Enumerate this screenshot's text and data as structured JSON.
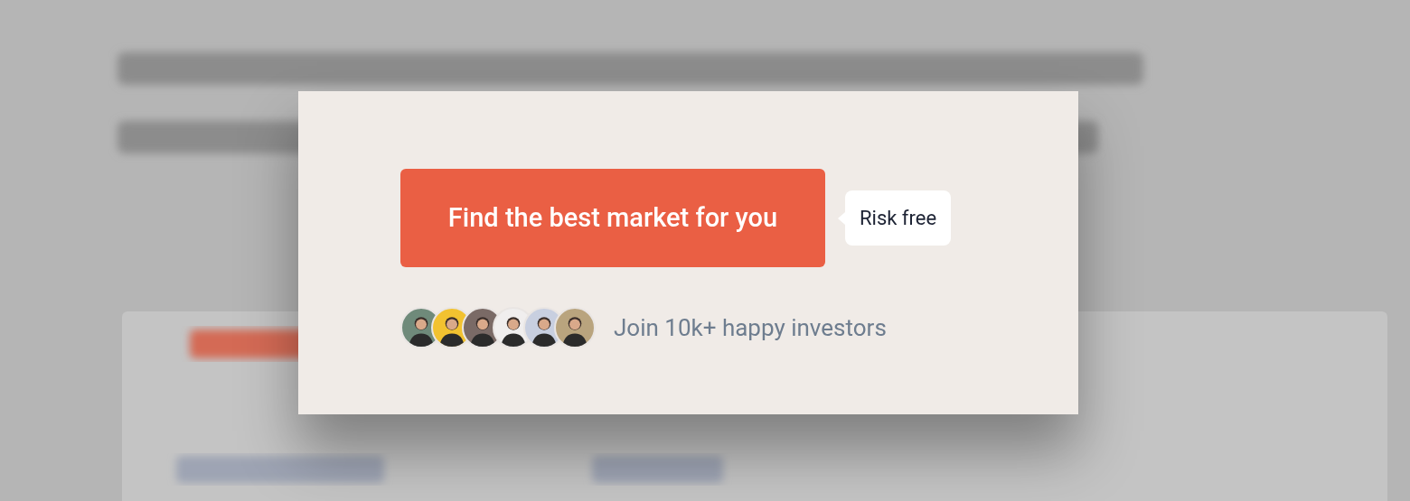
{
  "cta_button": {
    "label": "Find the best market for you"
  },
  "tooltip": {
    "label": "Risk free"
  },
  "avatars": [
    {
      "color": "#6f8a7a"
    },
    {
      "color": "#f2c230"
    },
    {
      "color": "#7a6a66"
    },
    {
      "color": "#f0eeee"
    },
    {
      "color": "#c8cfe0"
    },
    {
      "color": "#b9a47e"
    }
  ],
  "social_proof": "Join 10k+ happy investors"
}
